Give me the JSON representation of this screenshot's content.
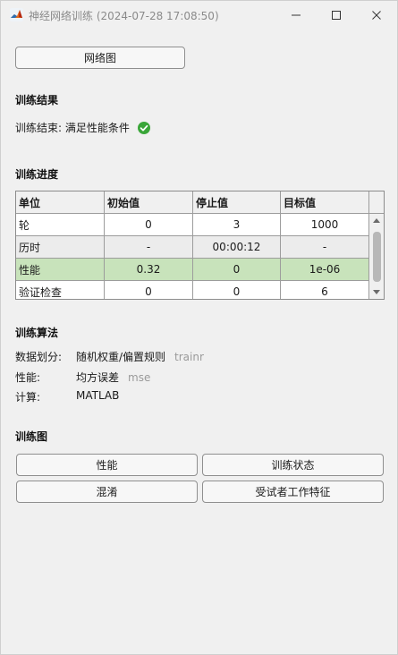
{
  "window": {
    "title": "神经网络训练 (2024-07-28 17:08:50)"
  },
  "icons": {
    "app": "matlab-logo-icon",
    "minimize": "minimize-icon",
    "maximize": "maximize-icon",
    "close": "close-icon",
    "status": "check-circle-icon"
  },
  "colors": {
    "highlight_row": "#c8e3bb",
    "check_green": "#3aa639"
  },
  "network_button": "网络图",
  "results": {
    "heading": "训练结果",
    "message": "训练结束: 满足性能条件"
  },
  "progress": {
    "heading": "训练进度",
    "columns": [
      "单位",
      "初始值",
      "停止值",
      "目标值"
    ],
    "rows": [
      {
        "unit": "轮",
        "initial": "0",
        "stop": "3",
        "target": "1000"
      },
      {
        "unit": "历时",
        "initial": "-",
        "stop": "00:00:12",
        "target": "-"
      },
      {
        "unit": "性能",
        "initial": "0.32",
        "stop": "0",
        "target": "1e-06"
      },
      {
        "unit": "验证检查",
        "initial": "0",
        "stop": "0",
        "target": "6"
      }
    ]
  },
  "algorithms": {
    "heading": "训练算法",
    "items": [
      {
        "label": "数据划分:",
        "value": "随机权重/偏置规则",
        "code": "trainr"
      },
      {
        "label": "性能:",
        "value": "均方误差",
        "code": "mse"
      },
      {
        "label": "计算:",
        "value": "MATLAB",
        "code": ""
      }
    ]
  },
  "plots": {
    "heading": "训练图",
    "buttons": [
      "性能",
      "训练状态",
      "混淆",
      "受试者工作特征"
    ]
  }
}
